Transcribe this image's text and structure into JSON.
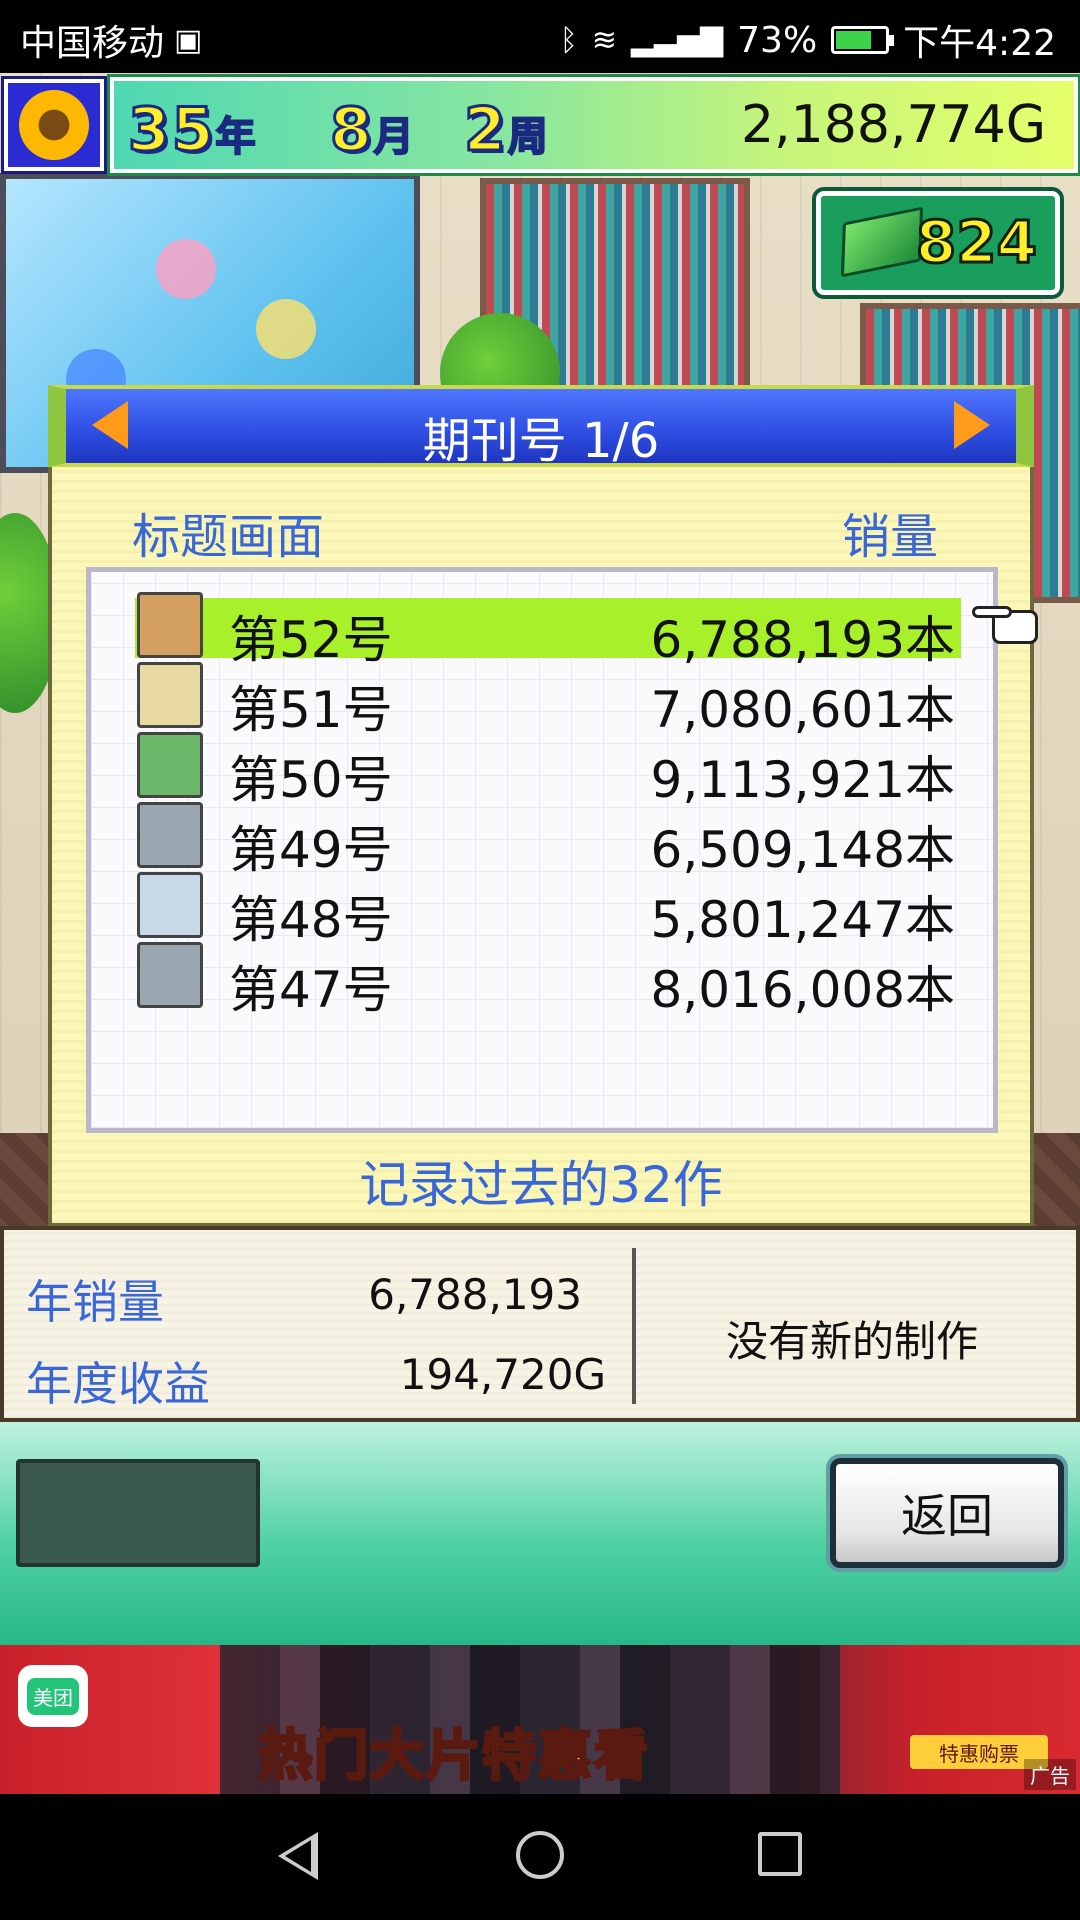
{
  "status_bar": {
    "carrier": "中国移动",
    "battery_percent": "73%",
    "battery_level": 0.73,
    "time": "下午4:22"
  },
  "hud": {
    "year": "35",
    "year_unit": "年",
    "month": "8",
    "month_unit": "月",
    "week": "2",
    "week_unit": "周",
    "money": "2,188,774G",
    "gems": "824"
  },
  "panel": {
    "title": "期刊号 1/6",
    "column_title": "标题画面",
    "column_sales": "销量",
    "rows": [
      {
        "name": "第52号",
        "sales": "6,788,193本",
        "selected": true,
        "icon_color": "#d4a060"
      },
      {
        "name": "第51号",
        "sales": "7,080,601本",
        "selected": false,
        "icon_color": "#e8d9a0"
      },
      {
        "name": "第50号",
        "sales": "9,113,921本",
        "selected": false,
        "icon_color": "#6bb86a"
      },
      {
        "name": "第49号",
        "sales": "6,509,148本",
        "selected": false,
        "icon_color": "#9aa6b0"
      },
      {
        "name": "第48号",
        "sales": "5,801,247本",
        "selected": false,
        "icon_color": "#c8d8e8"
      },
      {
        "name": "第47号",
        "sales": "8,016,008本",
        "selected": false,
        "icon_color": "#9aa6b0"
      }
    ],
    "record_text": "记录过去的32作"
  },
  "stats": {
    "annual_sales_label": "年销量",
    "annual_sales_value": "6,788,193",
    "annual_revenue_label": "年度收益",
    "annual_revenue_value": "194,720G",
    "no_new_text": "没有新的制作"
  },
  "controls": {
    "back_label": "返回"
  },
  "ad": {
    "brand": "美团",
    "headline": "热门大片特惠看",
    "button": "特惠购票",
    "tag": "广告"
  },
  "colors": {
    "selected_row": "#a8f02a",
    "header_blue": "#2d4de0",
    "label_blue": "#3a67d8"
  }
}
